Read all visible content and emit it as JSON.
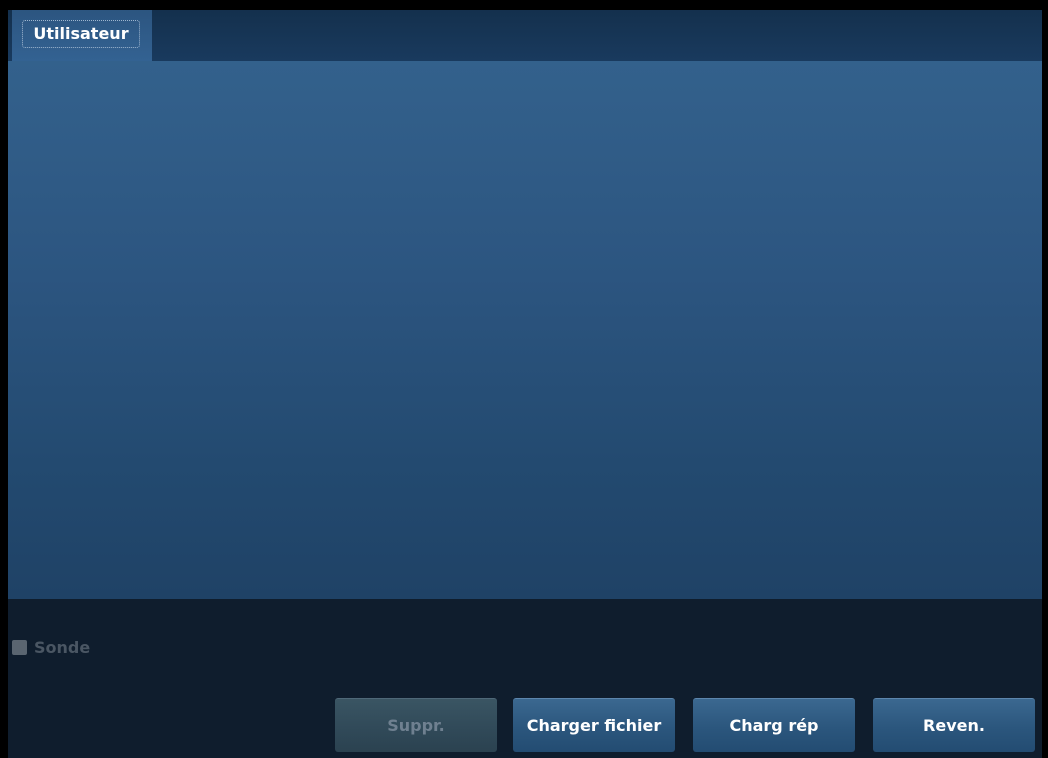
{
  "tabs": [
    {
      "label": "Utilisateur",
      "active": true
    }
  ],
  "probe": {
    "label": "Sonde",
    "checked": false,
    "enabled": false
  },
  "buttons": {
    "delete": {
      "label": "Suppr.",
      "enabled": false
    },
    "load_file": {
      "label": "Charger fichier",
      "enabled": true
    },
    "load_dir": {
      "label": "Charg rép",
      "enabled": true
    },
    "back": {
      "label": "Reven.",
      "enabled": true
    }
  },
  "colors": {
    "content_top": "#33618c",
    "content_bottom": "#1f4266",
    "background": "#0f1d2d"
  }
}
